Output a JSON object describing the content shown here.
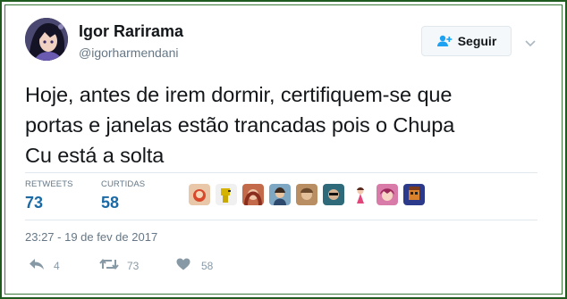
{
  "user": {
    "display_name": "Igor Rarirama",
    "handle": "@igorharmendani"
  },
  "follow": {
    "label": "Seguir"
  },
  "tweet": {
    "line1": "Hoje, antes de irem dormir, certifiquem-se que",
    "line2": "portas e janelas estão trancadas pois o Chupa",
    "line3": "Cu está a solta"
  },
  "stats": {
    "retweets_label": "RETWEETS",
    "retweets_value": "73",
    "likes_label": "CURTIDAS",
    "likes_value": "58"
  },
  "liker_avatars": [
    "avatar-1",
    "avatar-2",
    "avatar-3",
    "avatar-4",
    "avatar-5",
    "avatar-6",
    "avatar-7",
    "avatar-8",
    "avatar-9"
  ],
  "timestamp": "23:27 - 19 de fev de 2017",
  "actions": {
    "reply_count": "4",
    "retweet_count": "73",
    "like_count": "58"
  },
  "colors": {
    "frame": "#1f5a1f",
    "stat_value": "#1b6aa5",
    "muted": "#657786",
    "action_gray": "#8899a6"
  }
}
